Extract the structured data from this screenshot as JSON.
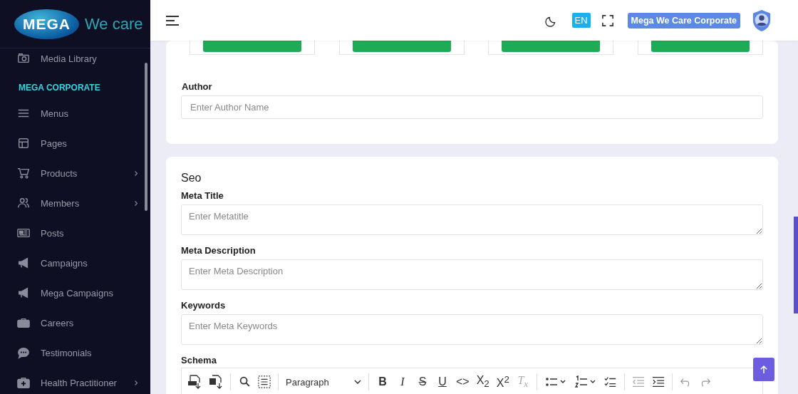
{
  "logo": {
    "mark": "MEGA",
    "tagline": "We care"
  },
  "sidebar": {
    "items": [
      {
        "label": "Media Library",
        "has_submenu": false
      }
    ],
    "section": "MEGA CORPORATE",
    "section_items": [
      {
        "label": "Menus",
        "has_submenu": false
      },
      {
        "label": "Pages",
        "has_submenu": false
      },
      {
        "label": "Products",
        "has_submenu": true
      },
      {
        "label": "Members",
        "has_submenu": true
      },
      {
        "label": "Posts",
        "has_submenu": false
      },
      {
        "label": "Campaigns",
        "has_submenu": false
      },
      {
        "label": "Mega Campaigns",
        "has_submenu": false
      },
      {
        "label": "Careers",
        "has_submenu": false
      },
      {
        "label": "Testimonials",
        "has_submenu": false
      },
      {
        "label": "Health Practitioner",
        "has_submenu": true
      }
    ]
  },
  "header": {
    "language": "EN",
    "account": "Mega We Care Corporate"
  },
  "uploads": [
    {
      "kind": "button"
    },
    {
      "kind": "button"
    },
    {
      "kind": "button"
    },
    {
      "kind": "button"
    }
  ],
  "author": {
    "label": "Author",
    "placeholder": "Enter Author Name"
  },
  "seo": {
    "title": "Seo",
    "fields": [
      {
        "label": "Meta Title",
        "placeholder": "Enter Metatitle"
      },
      {
        "label": "Meta Description",
        "placeholder": "Enter Meta Description"
      },
      {
        "label": "Keywords",
        "placeholder": "Enter Meta Keywords"
      }
    ],
    "schema_label": "Schema",
    "format": "Paragraph",
    "format_buttons": [
      "B",
      "I",
      "S",
      "U",
      "<>",
      "X$_{2}$",
      "X$^{2}$",
      "T$_{x}$"
    ]
  }
}
